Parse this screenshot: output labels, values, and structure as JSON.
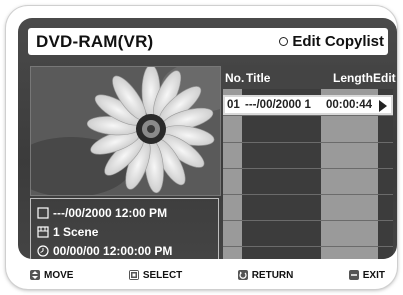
{
  "header": {
    "title": "DVD-RAM(VR)",
    "mode": "Edit Copylist"
  },
  "info": {
    "date_time": "---/00/2000 12:00 PM",
    "scenes": "1 Scene",
    "elapsed": "00/00/00 12:00:00 PM"
  },
  "table": {
    "headers": {
      "no": "No.",
      "title": "Title",
      "length": "Length",
      "edit": "Edit"
    },
    "rows": [
      {
        "no": "01",
        "title": "---/00/2000 1",
        "length": "00:00:44"
      }
    ]
  },
  "footer": {
    "move": "MOVE",
    "select": "SELECT",
    "return": "RETURN",
    "exit": "EXIT"
  },
  "icons": [
    "radio-ring-icon",
    "calendar-icon",
    "scene-icon",
    "clock-icon",
    "play-arrow-icon",
    "updown-key-icon",
    "enter-key-icon",
    "return-key-icon",
    "exit-key-icon"
  ]
}
